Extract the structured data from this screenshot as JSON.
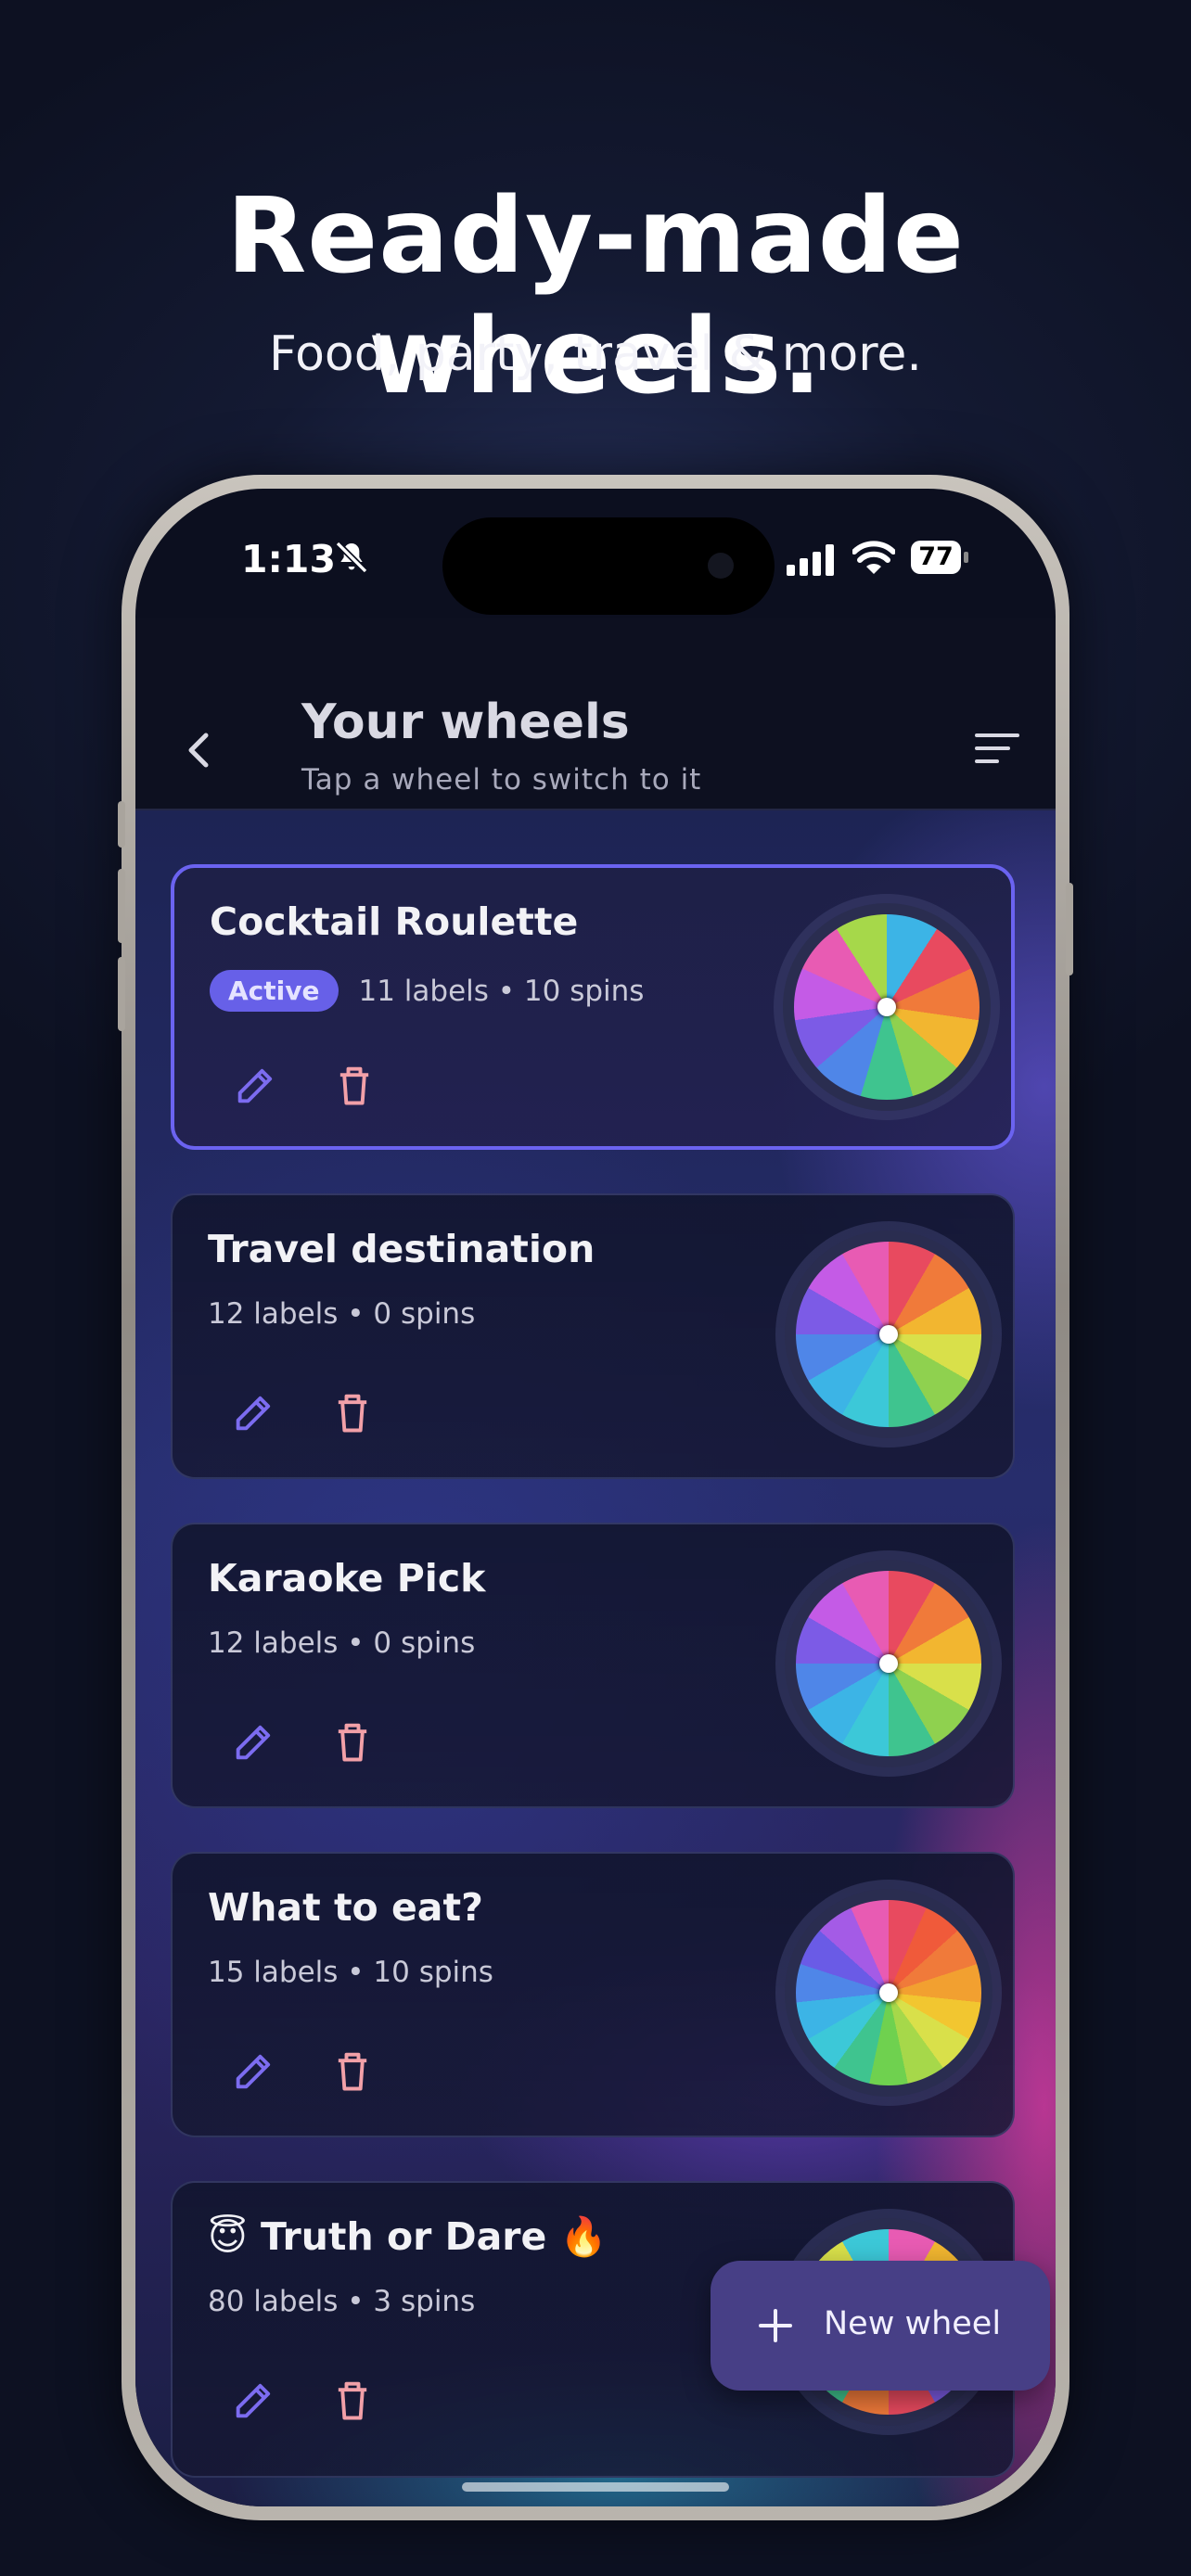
{
  "promo": {
    "title": "Ready-made wheels.",
    "subtitle": "Food, party, travel & more."
  },
  "status_bar": {
    "time": "1:13",
    "battery": "77",
    "icons": [
      "bell-slash-icon",
      "signal-icon",
      "wifi-icon",
      "battery-icon"
    ]
  },
  "header": {
    "title": "Your wheels",
    "subtitle": "Tap a wheel to switch to it",
    "back_icon": "chevron-left-icon",
    "sort_icon": "sort-lines-icon"
  },
  "wheels": [
    {
      "title": "Cocktail Roulette",
      "badge": "Active",
      "meta": "11 labels • 10 spins",
      "active": true,
      "slice_colors": [
        "#3cb4e6",
        "#e84a5f",
        "#f07a3a",
        "#f2b630",
        "#8fd14f",
        "#3fc48f",
        "#4f86e8",
        "#7c5be6",
        "#c45be6",
        "#e85bb3",
        "#a6d84a"
      ]
    },
    {
      "title": "Travel destination",
      "meta": "12 labels • 0 spins",
      "active": false,
      "slice_colors": [
        "#e84a5f",
        "#f07a3a",
        "#f2b630",
        "#d9e04a",
        "#8fd14f",
        "#3fc48f",
        "#3cc8d8",
        "#3cb4e6",
        "#4f86e8",
        "#7c5be6",
        "#c45be6",
        "#e85bb3"
      ]
    },
    {
      "title": "Karaoke Pick",
      "meta": "12 labels • 0 spins",
      "active": false,
      "slice_colors": [
        "#e84a5f",
        "#f07a3a",
        "#f2b630",
        "#d9e04a",
        "#8fd14f",
        "#3fc48f",
        "#3cc8d8",
        "#3cb4e6",
        "#4f86e8",
        "#7c5be6",
        "#c45be6",
        "#e85bb3"
      ]
    },
    {
      "title": "What to eat?",
      "meta": "15 labels • 10 spins",
      "active": false,
      "slice_colors": [
        "#e84a5f",
        "#f05a3a",
        "#f07a3a",
        "#f2a030",
        "#f2c630",
        "#d9e04a",
        "#a6d84a",
        "#6fd14f",
        "#3fc48f",
        "#3cc8d8",
        "#3cb4e6",
        "#4f86e8",
        "#6a5be6",
        "#a45be6",
        "#e85bb3"
      ]
    },
    {
      "title": "😇 Truth or Dare 🔥",
      "meta": "80 labels • 3 spins",
      "active": false,
      "slice_colors": [
        "#e85bb3",
        "#f2b630",
        "#8fd14f",
        "#3cb4e6",
        "#7c5be6",
        "#e84a5f",
        "#f07a3a",
        "#3fc48f",
        "#4f86e8",
        "#c45be6",
        "#d9e04a",
        "#3cc8d8"
      ]
    }
  ],
  "actions": {
    "edit_icon": "pencil-icon",
    "delete_icon": "trash-icon"
  },
  "fab": {
    "label": "New wheel",
    "icon": "plus-icon"
  },
  "colors": {
    "accent": "#6b63f0",
    "fab": "#473f86",
    "delete": "#f2a0a8",
    "edit": "#7c6cf0"
  }
}
